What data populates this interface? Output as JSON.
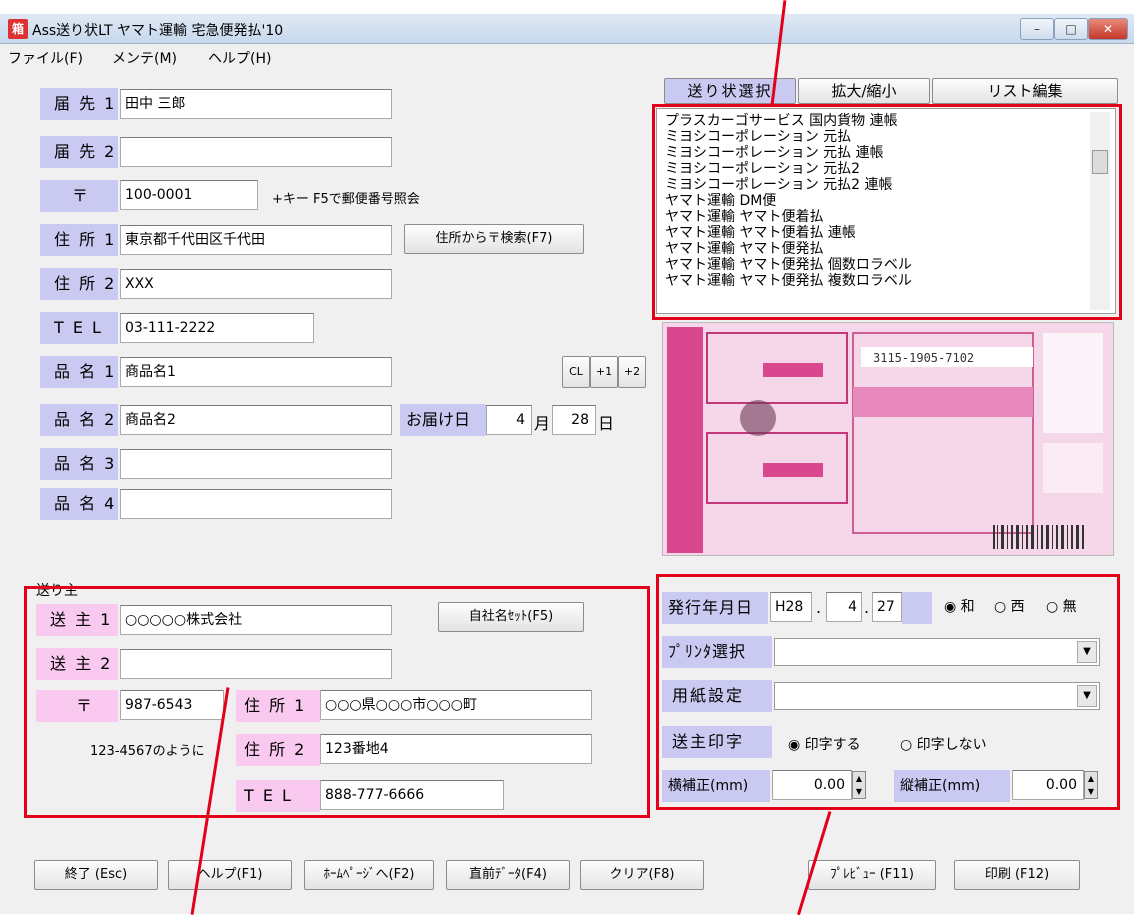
{
  "window": {
    "title": "Ass送り状LT ヤマト運輸 宅急便発払'10",
    "icon_text": "箱",
    "min": "–",
    "max": "□",
    "close": "✕"
  },
  "menu": [
    "ファイル(F)",
    "メンテ(M)",
    "ヘルプ(H)"
  ],
  "recipient": {
    "dest1_label": "届 先 1",
    "dest1": "田中 三郎",
    "dest2_label": "届 先 2",
    "dest2": "",
    "zip_label": "〒",
    "zip": "100-0001",
    "zip_hint": "+キー F5で郵便番号照会",
    "addr1_label": "住 所 1",
    "addr1": "東京都千代田区千代田",
    "zip_search_button": "住所から〒検索(F7)",
    "addr2_label": "住 所 2",
    "addr2": "XXX",
    "tel_label": "T E L",
    "tel": "03-111-2222",
    "item1_label": "品 名 1",
    "item1": "商品名1",
    "item2_label": "品 名 2",
    "item2": "商品名2",
    "item3_label": "品 名 3",
    "item3": "",
    "item4_label": "品 名 4",
    "item4": "",
    "cl_button": "CL",
    "plus1_button": "+1",
    "plus2_button": "+2",
    "delivery_label": "お届け日",
    "delivery_month": "4",
    "month_unit": "月",
    "delivery_day": "28",
    "day_unit": "日"
  },
  "slip": {
    "select_tab": "送り状選択",
    "zoom_button": "拡大/縮小",
    "list_edit_button": "リスト編集",
    "list": [
      "プラスカーゴサービス 国内貨物 連帳",
      "ミヨシコーポレーション 元払",
      "ミヨシコーポレーション 元払 連帳",
      "ミヨシコーポレーション 元払2",
      "ミヨシコーポレーション 元払2 連帳",
      "ヤマト運輸 DM便",
      "ヤマト運輸 ヤマト便着払",
      "ヤマト運輸 ヤマト便着払 連帳",
      "ヤマト運輸 ヤマト便発払",
      "ヤマト運輸 ヤマト便発払 個数ロラベル",
      "ヤマト運輸 ヤマト便発払 複数ロラベル"
    ],
    "preview_number": "3115-1905-7102"
  },
  "sender": {
    "section_title": "送り主",
    "sender1_label": "送 主 1",
    "sender1": "○○○○○株式会社",
    "own_name_button": "自社名ｾｯﾄ(F5)",
    "sender2_label": "送 主 2",
    "sender2": "",
    "zip_label": "〒",
    "zip": "987-6543",
    "zip_example": "123-4567のように",
    "addr1_label": "住 所 1",
    "addr1": "○○○県○○○市○○○町",
    "addr2_label": "住 所 2",
    "addr2": "123番地4",
    "tel_label": "T E L",
    "tel": "888-777-6666"
  },
  "print": {
    "issue_date_label": "発行年月日",
    "era": "H28",
    "month": "4",
    "day": "27",
    "sep": ".",
    "era_japanese": "和",
    "era_western": "西",
    "era_none": "無",
    "printer_label": "ﾌﾟﾘﾝﾀ選択",
    "printer_value": "",
    "paper_label": "用紙設定",
    "paper_value": "",
    "sender_print_label": "送主印字",
    "print_yes": "印字する",
    "print_no": "印字しない",
    "h_offset_label": "横補正(mm)",
    "h_offset": "0.00",
    "v_offset_label": "縦補正(mm)",
    "v_offset": "0.00"
  },
  "buttons": {
    "exit": "終了 (Esc)",
    "help": "ヘルプ(F1)",
    "homepage": "ﾎｰﾑﾍﾟｰｼﾞへ(F2)",
    "prev_data": "直前ﾃﾞｰﾀ(F4)",
    "clear": "クリア(F8)",
    "preview": "ﾌﾟﾚﾋﾞｭｰ (F11)",
    "print": "印刷 (F12)"
  },
  "colors": {
    "label_blue": "#c9c9f2",
    "label_pink": "#f9c9f0",
    "highlight": "#e4001b"
  }
}
